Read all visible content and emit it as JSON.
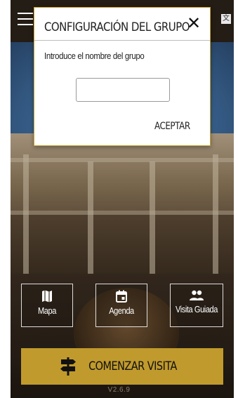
{
  "dialog": {
    "title": "CONFIGURACIÓN DEL GRUPO",
    "close_label": "✕",
    "prompt": "Introduce el nombre del grupo",
    "input_value": "",
    "accept_label": "ACEPTAR"
  },
  "tiles": [
    {
      "label": "Mapa",
      "icon": "map-icon"
    },
    {
      "label": "Agenda",
      "icon": "calendar-icon"
    },
    {
      "label": "Visita Guiada",
      "icon": "group-icon"
    }
  ],
  "start_button": {
    "label": "COMENZAR VISITA",
    "icon": "signpost-icon"
  },
  "version": "V2.6.9",
  "colors": {
    "accent": "#c09a2c",
    "dialog_border": "#c9a227"
  }
}
